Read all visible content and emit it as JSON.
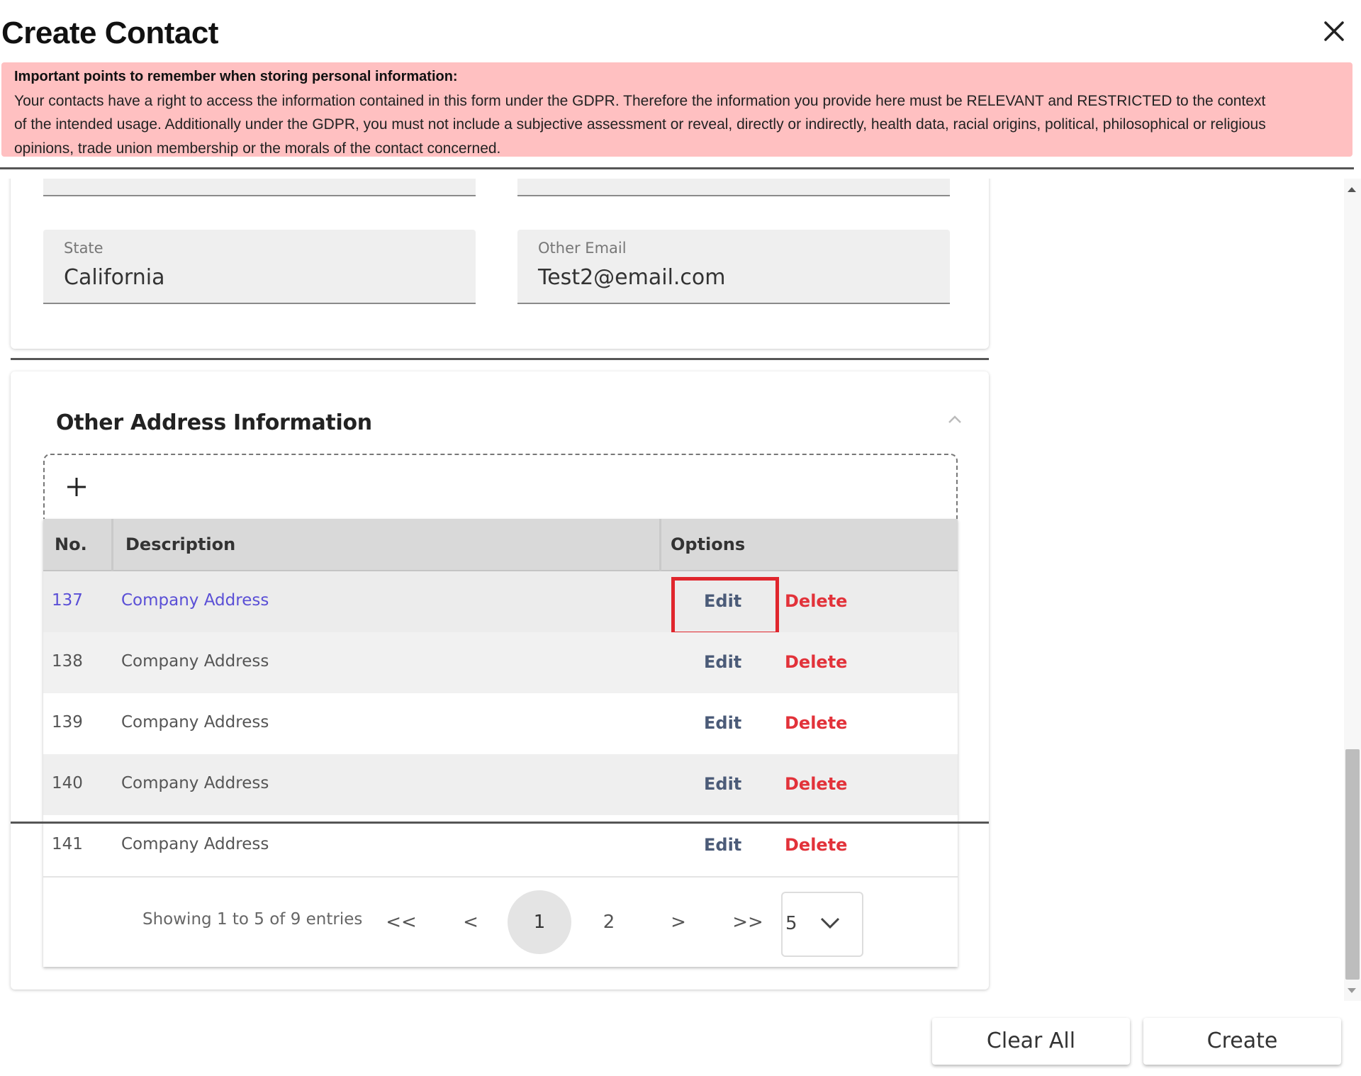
{
  "dialog": {
    "title": "Create Contact"
  },
  "gdpr_notice": {
    "heading": "Important points to remember when storing personal information:",
    "line1": "Your contacts have a right to access the information contained in this form under the GDPR. Therefore the information you provide here must be RELEVANT and RESTRICTED to the context",
    "line2": "of the intended usage. Additionally under the GDPR, you must not include a subjective assessment or reveal, directly or indirectly, health data, racial origins, political, philosophical or religious",
    "line3": "opinions, trade union membership or the morals of the contact concerned."
  },
  "contact_fields": {
    "state": {
      "label": "State",
      "value": "California"
    },
    "other_email": {
      "label": "Other Email",
      "value": "Test2@email.com"
    }
  },
  "other_address": {
    "title": "Other Address Information",
    "columns": {
      "no": "No.",
      "description": "Description",
      "options": "Options"
    },
    "rows": [
      {
        "no": "137",
        "description": "Company Address",
        "edit": "Edit",
        "delete": "Delete"
      },
      {
        "no": "138",
        "description": "Company Address",
        "edit": "Edit",
        "delete": "Delete"
      },
      {
        "no": "139",
        "description": "Company Address",
        "edit": "Edit",
        "delete": "Delete"
      },
      {
        "no": "140",
        "description": "Company Address",
        "edit": "Edit",
        "delete": "Delete"
      },
      {
        "no": "141",
        "description": "Company Address",
        "edit": "Edit",
        "delete": "Delete"
      }
    ],
    "pagination": {
      "summary": "Showing 1 to 5 of 9 entries",
      "first": "<<",
      "prev": "<",
      "pages": [
        "1",
        "2"
      ],
      "current_page": "1",
      "next": ">",
      "last": ">>",
      "page_size": "5"
    }
  },
  "footer": {
    "clear_label": "Clear All",
    "create_label": "Create"
  },
  "colors": {
    "gdpr_background": "#ffc0c1",
    "link": "#5a4fd6",
    "edit": "#4b5b78",
    "delete": "#e2323a",
    "highlight": "#e0262d"
  }
}
